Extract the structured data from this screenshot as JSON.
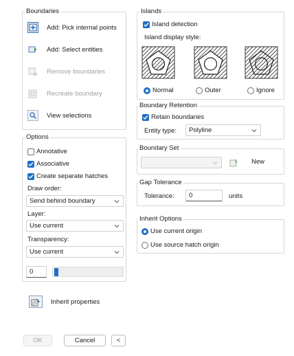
{
  "boundaries": {
    "title": "Boundaries",
    "add_pick": "Add: Pick internal points",
    "add_select": "Add: Select entities",
    "remove": "Remove boundaries",
    "recreate": "Recreate boundary",
    "view": "View selections"
  },
  "options": {
    "title": "Options",
    "annotative": "Annotative",
    "associative": "Associative",
    "separate": "Create separate hatches",
    "draw_order_label": "Draw order:",
    "draw_order_value": "Send behind boundary",
    "layer_label": "Layer:",
    "layer_value": "Use current",
    "transparency_label": "Transparency:",
    "transparency_value": "Use current",
    "transparency_number": "0",
    "transparency_level": 0
  },
  "inherit_properties": "Inherit properties",
  "footer": {
    "ok": "OK",
    "cancel": "Cancel",
    "collapse": "<"
  },
  "islands": {
    "title": "Islands",
    "detection": "Island detection",
    "style_label": "Island display style:",
    "normal": "Normal",
    "outer": "Outer",
    "ignore": "Ignore"
  },
  "retention": {
    "title": "Boundary Retention",
    "retain": "Retain boundaries",
    "entity_label": "Entity type:",
    "entity_value": "Polyline"
  },
  "boundary_set": {
    "title": "Boundary Set",
    "new": "New"
  },
  "gap": {
    "title": "Gap Tolerance",
    "label": "Tolerance:",
    "value": "0",
    "units": "units"
  },
  "inherit_options": {
    "title": "Inherit Options",
    "current": "Use current origin",
    "source": "Use source hatch origin"
  },
  "colors": {
    "accent": "#1f6fc5",
    "border": "#d6d6d6",
    "disabled": "#a0a0a0"
  }
}
